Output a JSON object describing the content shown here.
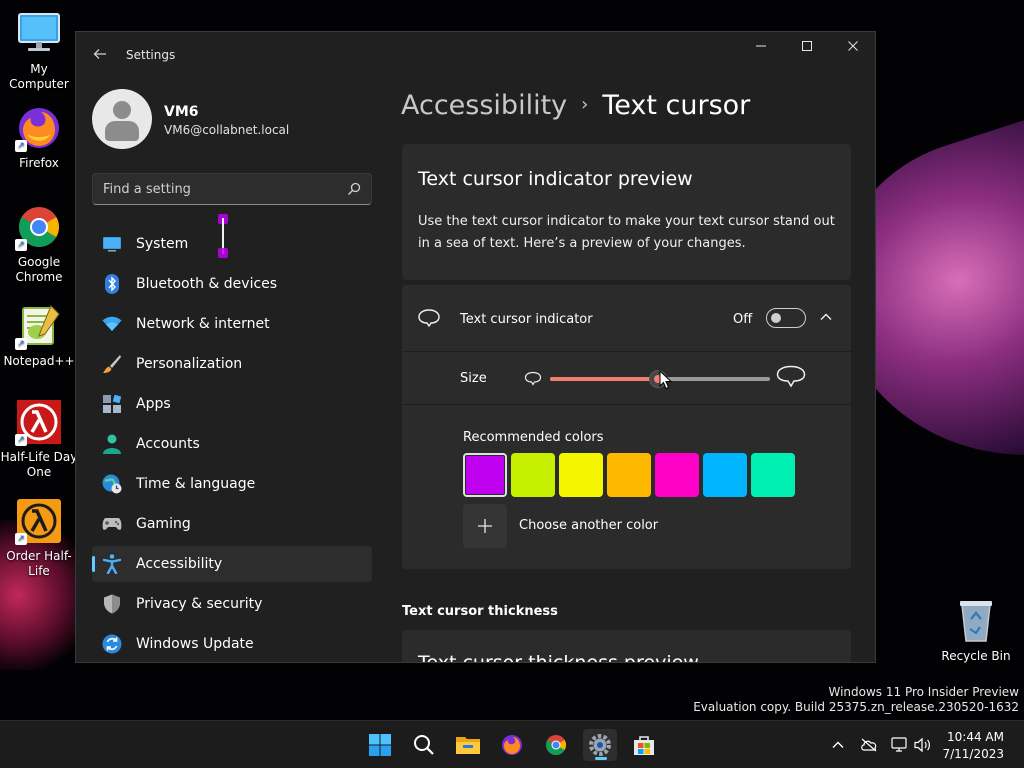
{
  "desktop": {
    "icons": [
      {
        "label": "My Computer"
      },
      {
        "label": "Firefox"
      },
      {
        "label": "Google Chrome"
      },
      {
        "label": "Notepad++"
      },
      {
        "label": "Half-Life Day One"
      },
      {
        "label": "Order Half-Life"
      }
    ],
    "recycle_bin": "Recycle Bin",
    "watermark": {
      "line1": "Windows 11 Pro Insider Preview",
      "line2": "Evaluation copy. Build 25375.zn_release.230520-1632"
    }
  },
  "window": {
    "title": "Settings",
    "controls": {
      "minimize": "minimize-icon",
      "maximize": "maximize-icon",
      "close": "close-icon"
    }
  },
  "profile": {
    "name": "VM6",
    "email": "VM6@collabnet.local"
  },
  "search": {
    "placeholder": "Find a setting"
  },
  "nav": {
    "items": [
      {
        "label": "System",
        "icon": "monitor-icon"
      },
      {
        "label": "Bluetooth & devices",
        "icon": "bluetooth-icon"
      },
      {
        "label": "Network & internet",
        "icon": "wifi-icon"
      },
      {
        "label": "Personalization",
        "icon": "brush-icon"
      },
      {
        "label": "Apps",
        "icon": "apps-icon"
      },
      {
        "label": "Accounts",
        "icon": "person-icon"
      },
      {
        "label": "Time & language",
        "icon": "globe-clock-icon"
      },
      {
        "label": "Gaming",
        "icon": "gamepad-icon"
      },
      {
        "label": "Accessibility",
        "icon": "accessibility-icon",
        "active": true
      },
      {
        "label": "Privacy & security",
        "icon": "shield-icon"
      },
      {
        "label": "Windows Update",
        "icon": "update-icon"
      }
    ]
  },
  "breadcrumb": {
    "parent": "Accessibility",
    "separator": "›",
    "current": "Text cursor"
  },
  "preview": {
    "title": "Text cursor indicator preview",
    "text": "Use the text cursor indicator to make your text cursor stand out in a sea of text. Here’s a preview of your changes."
  },
  "indicator": {
    "label": "Text cursor indicator",
    "state_label": "Off",
    "enabled": false,
    "size_label": "Size",
    "size_value_fraction": 0.49,
    "colors_label": "Recommended colors",
    "colors": [
      "#c000f0",
      "#c6f000",
      "#f5f500",
      "#ffb800",
      "#ff00c6",
      "#00b4ff",
      "#00f0b4"
    ],
    "selected_color_index": 0,
    "choose_color_label": "Choose another color"
  },
  "thickness": {
    "heading": "Text cursor thickness",
    "preview_title": "Text cursor thickness preview"
  },
  "taskbar": {
    "apps": [
      {
        "name": "start-button"
      },
      {
        "name": "search-button"
      },
      {
        "name": "file-explorer"
      },
      {
        "name": "firefox"
      },
      {
        "name": "chrome"
      },
      {
        "name": "settings",
        "active": true
      },
      {
        "name": "store"
      }
    ],
    "time": "10:44 AM",
    "date": "7/11/2023"
  },
  "colors": {
    "accent": "#60cdff",
    "slider": "#f0806e",
    "window_bg": "#202020",
    "card_bg": "#2b2b2b"
  }
}
